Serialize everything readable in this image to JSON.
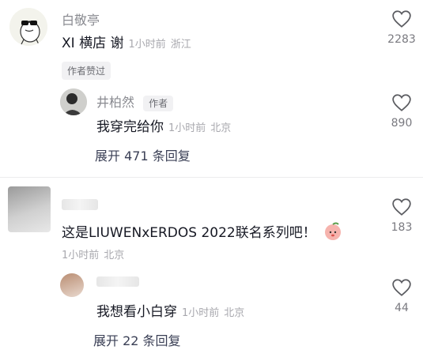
{
  "comments": [
    {
      "author": "白敬亭",
      "text": "XI 横店 谢",
      "time": "1小时前",
      "location": "浙江",
      "likes": "2283",
      "author_liked_tag": "作者赞过",
      "reply": {
        "author": "井柏然",
        "author_tag": "作者",
        "text": "我穿完给你",
        "time": "1小时前",
        "location": "北京",
        "likes": "890"
      },
      "expand_label": "展开 471 条回复"
    },
    {
      "text": "这是LIUWENxERDOS 2022联名系列吧！",
      "time": "1小时前",
      "location": "北京",
      "likes": "183",
      "reply": {
        "text": "我想看小白穿",
        "time": "1小时前",
        "location": "北京",
        "likes": "44"
      },
      "expand_label": "展开 22 条回复"
    }
  ],
  "icons": {
    "like": "heart-outline-icon",
    "emoji": "peach-face-emoji-icon"
  },
  "colors": {
    "text": "#161823",
    "muted": "#a8a8ae",
    "expand": "#3a3f55"
  }
}
